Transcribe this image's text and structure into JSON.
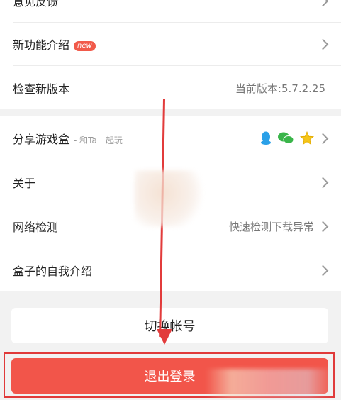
{
  "settings": {
    "items_top": [
      {
        "label": "意见反馈"
      },
      {
        "label": "新功能介绍",
        "badge": "new"
      },
      {
        "label": "检查新版本",
        "value": "当前版本:5.7.2.25"
      }
    ],
    "items_bottom": [
      {
        "label": "分享游戏盒",
        "sub": "- 和Ta一起玩"
      },
      {
        "label": "关于"
      },
      {
        "label": "网络检测",
        "value": "快速检测下载异常"
      },
      {
        "label": "盒子的自我介绍"
      }
    ]
  },
  "buttons": {
    "switch_account": "切换帐号",
    "logout": "退出登录"
  },
  "share_icons": [
    "qq-icon",
    "wechat-icon",
    "qzone-star-icon"
  ],
  "colors": {
    "accent": "#f2554a",
    "annotation": "#e03a3a"
  }
}
